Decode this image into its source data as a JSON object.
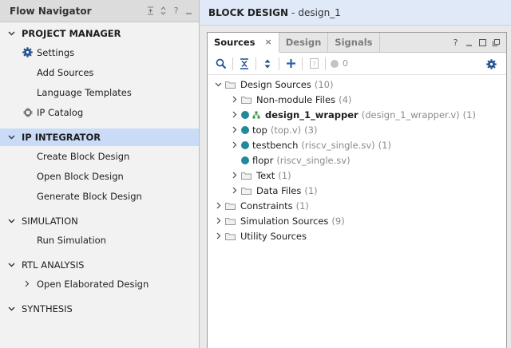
{
  "flow_navigator": {
    "title": "Flow Navigator",
    "header_controls": [
      "collapse-all",
      "expand-all",
      "help",
      "minimize"
    ],
    "sections": [
      {
        "id": "project-manager",
        "label": "PROJECT MANAGER",
        "bold": true,
        "selected": false,
        "items": [
          {
            "label": "Settings",
            "icon": "gear-icon"
          },
          {
            "label": "Add Sources"
          },
          {
            "label": "Language Templates"
          },
          {
            "label": "IP Catalog",
            "icon": "ip-catalog-icon"
          }
        ]
      },
      {
        "id": "ip-integrator",
        "label": "IP INTEGRATOR",
        "bold": true,
        "selected": true,
        "items": [
          {
            "label": "Create Block Design"
          },
          {
            "label": "Open Block Design"
          },
          {
            "label": "Generate Block Design"
          }
        ]
      },
      {
        "id": "simulation",
        "label": "SIMULATION",
        "bold": false,
        "selected": false,
        "items": [
          {
            "label": "Run Simulation"
          }
        ]
      },
      {
        "id": "rtl-analysis",
        "label": "RTL ANALYSIS",
        "bold": false,
        "selected": false,
        "items": [
          {
            "label": "Open Elaborated Design",
            "expandable": true
          }
        ]
      },
      {
        "id": "synthesis",
        "label": "SYNTHESIS",
        "bold": false,
        "selected": false,
        "items": []
      }
    ]
  },
  "block_design": {
    "title": "BLOCK DESIGN",
    "separator": "-",
    "design_name": "design_1"
  },
  "sources_panel": {
    "tabs": [
      {
        "label": "Sources",
        "active": true,
        "closable": true
      },
      {
        "label": "Design",
        "active": false
      },
      {
        "label": "Signals",
        "active": false
      }
    ],
    "close_glyph": "×",
    "toolbar": {
      "count": "0"
    },
    "tree": {
      "design_sources": {
        "label": "Design Sources",
        "count": "(10)"
      },
      "non_module": {
        "label": "Non-module Files",
        "count": "(4)"
      },
      "design_wrapper": {
        "label": "design_1_wrapper",
        "file": "(design_1_wrapper.v)",
        "count": "(1)"
      },
      "top": {
        "label": "top",
        "file": "(top.v)",
        "count": "(3)"
      },
      "testbench": {
        "label": "testbench",
        "file": "(riscv_single.sv)",
        "count": "(1)"
      },
      "flopr": {
        "label": "flopr",
        "file": "(riscv_single.sv)"
      },
      "text": {
        "label": "Text",
        "count": "(1)"
      },
      "data_files": {
        "label": "Data Files",
        "count": "(1)"
      },
      "constraints": {
        "label": "Constraints",
        "count": "(1)"
      },
      "sim_sources": {
        "label": "Simulation Sources",
        "count": "(9)"
      },
      "utility_sources": {
        "label": "Utility Sources"
      }
    }
  },
  "colors": {
    "accent_selected": "#c9dbf7",
    "header_blue": "#dfe9f8",
    "module_dot": "#23889b",
    "action_blue": "#2a62b5"
  }
}
